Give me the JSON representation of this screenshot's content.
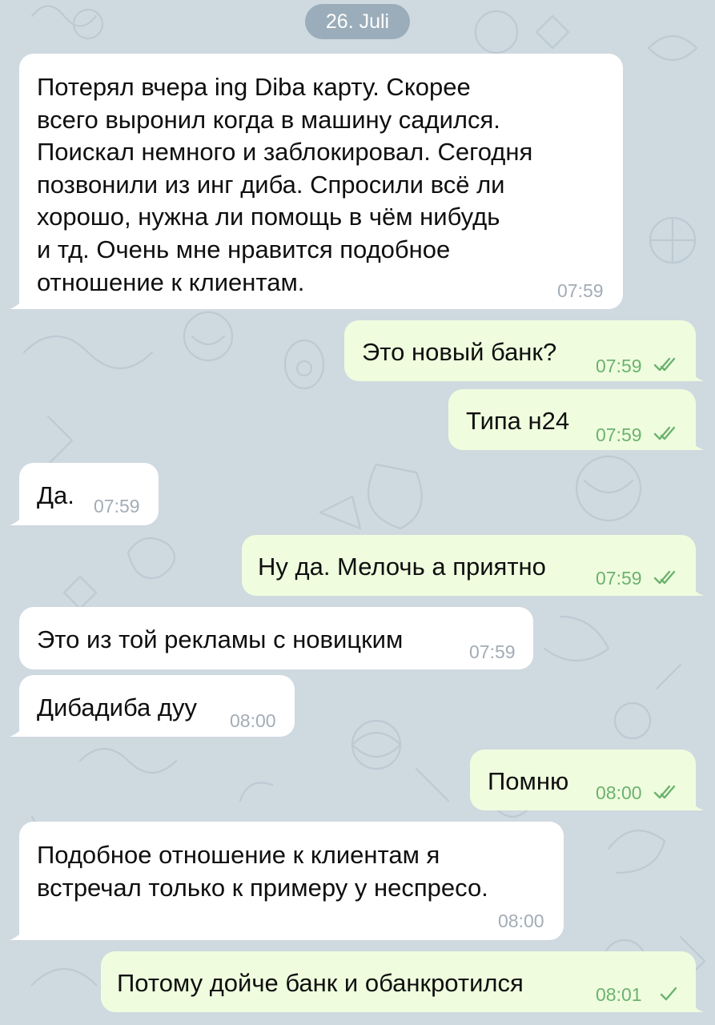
{
  "chat": {
    "date_chip": "26. Juli",
    "messages": [
      {
        "direction": "incoming",
        "text": "Потерял вчера ing Diba карту. Скорее\nвсего выронил когда в машину садился.\nПоискал немного и заблокировал. Сегодня\nпозвонили из инг диба. Спросили всё ли\nхорошо, нужна ли помощь в чём нибудь\nи тд. Очень мне нравится подобное\nотношение к клиентам.",
        "time": "07:59"
      },
      {
        "direction": "outgoing",
        "text": "Это новый банк?",
        "time": "07:59",
        "status": "read"
      },
      {
        "direction": "outgoing",
        "text": "Типа н24",
        "time": "07:59",
        "status": "read"
      },
      {
        "direction": "incoming",
        "text": "Да.",
        "time": "07:59"
      },
      {
        "direction": "outgoing",
        "text": "Ну да. Мелочь а приятно",
        "time": "07:59",
        "status": "read"
      },
      {
        "direction": "incoming",
        "text": "Это из той рекламы с новицким",
        "time": "07:59"
      },
      {
        "direction": "incoming",
        "text": "Дибадиба дуу",
        "time": "08:00"
      },
      {
        "direction": "outgoing",
        "text": "Помню",
        "time": "08:00",
        "status": "read"
      },
      {
        "direction": "incoming",
        "text": "Подобное отношение к клиентам я\nвстречал только к примеру у неспресо.",
        "time": "08:00"
      },
      {
        "direction": "outgoing",
        "text": "Потому дойче банк и обанкротился",
        "time": "08:01",
        "status": "sent"
      }
    ]
  },
  "colors": {
    "background": "#cfd9e0",
    "incoming_bubble": "#ffffff",
    "outgoing_bubble": "#effdde",
    "outgoing_time": "#6cb26f",
    "incoming_time": "#a3acb5",
    "date_chip": "#7a91a3"
  },
  "icons": {
    "read_status": "double-check-icon",
    "sent_status": "single-check-icon"
  }
}
